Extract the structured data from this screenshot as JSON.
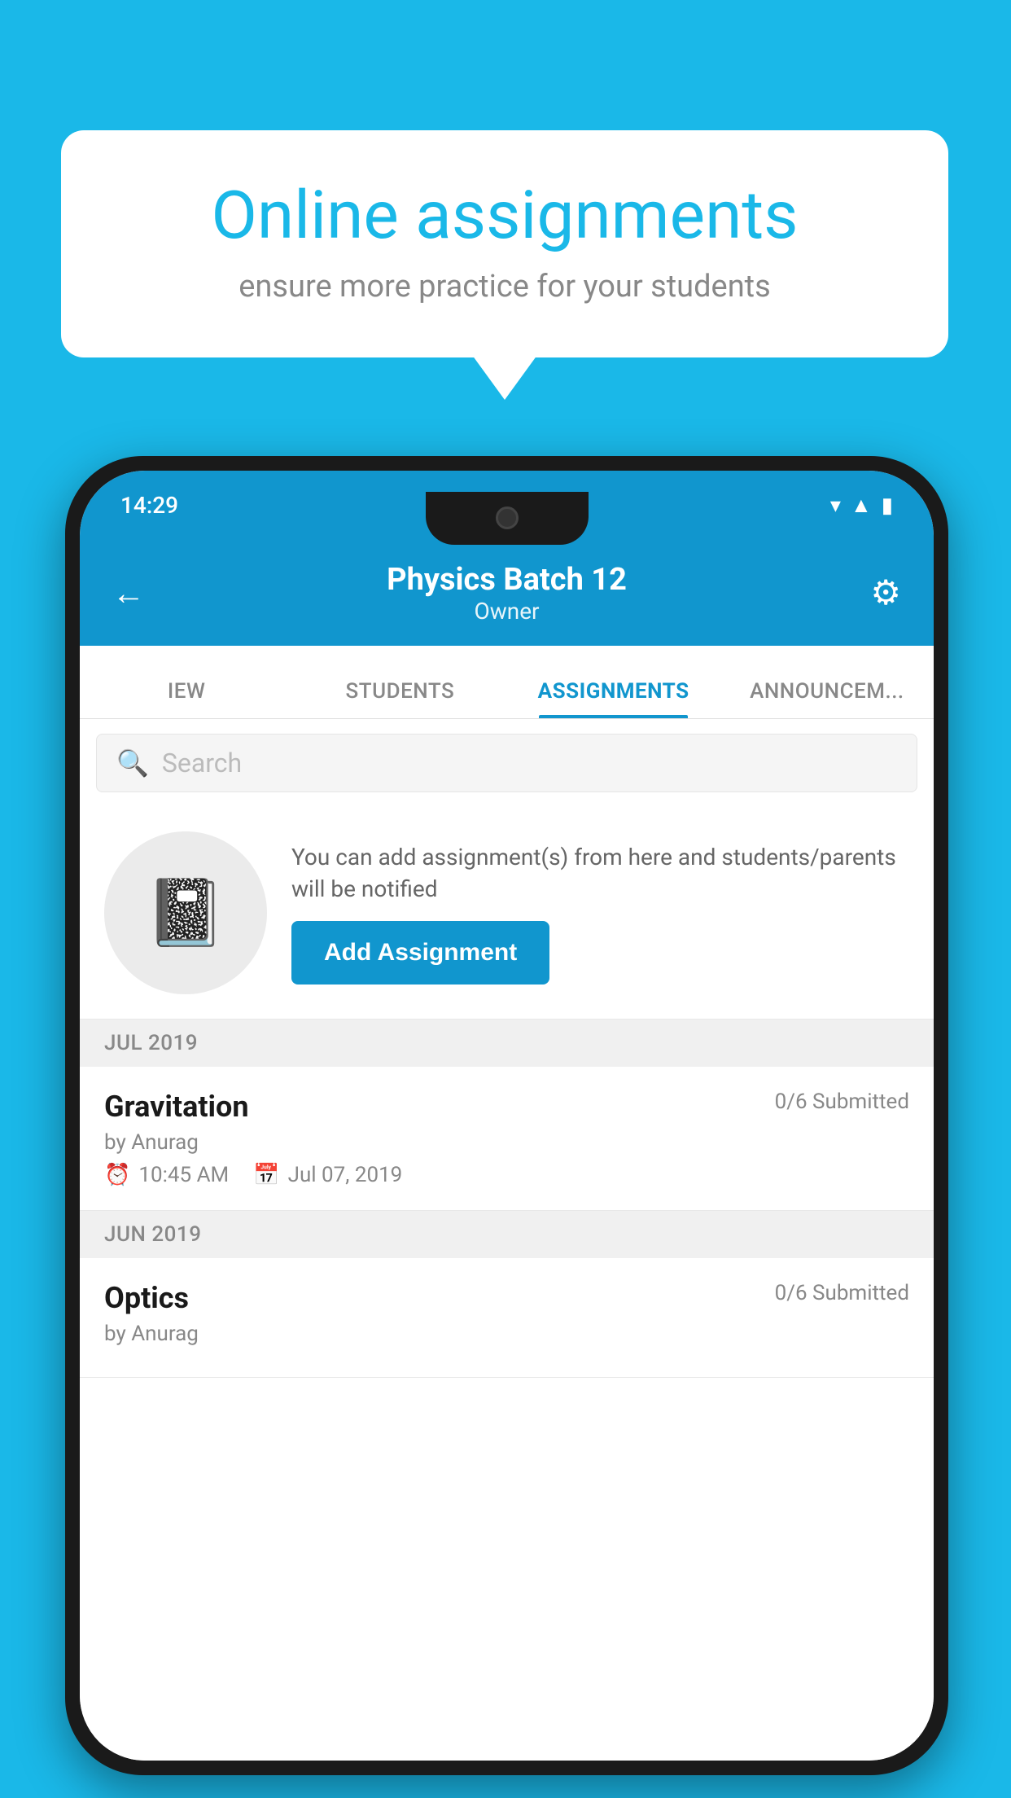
{
  "background_color": "#1ab8e8",
  "speech_bubble": {
    "title": "Online assignments",
    "subtitle": "ensure more practice for your students"
  },
  "phone": {
    "status_bar": {
      "time": "14:29",
      "icons": [
        "wifi",
        "signal",
        "battery"
      ]
    },
    "header": {
      "back_label": "←",
      "title": "Physics Batch 12",
      "subtitle": "Owner",
      "gear_label": "⚙"
    },
    "tabs": [
      {
        "label": "IEW",
        "active": false
      },
      {
        "label": "STUDENTS",
        "active": false
      },
      {
        "label": "ASSIGNMENTS",
        "active": true
      },
      {
        "label": "ANNOUNCEM...",
        "active": false
      }
    ],
    "search": {
      "placeholder": "Search"
    },
    "promo": {
      "description": "You can add assignment(s) from here and students/parents will be notified",
      "button_label": "Add Assignment"
    },
    "months": [
      {
        "label": "JUL 2019",
        "assignments": [
          {
            "name": "Gravitation",
            "submitted": "0/6 Submitted",
            "by": "by Anurag",
            "time": "10:45 AM",
            "date": "Jul 07, 2019"
          }
        ]
      },
      {
        "label": "JUN 2019",
        "assignments": [
          {
            "name": "Optics",
            "submitted": "0/6 Submitted",
            "by": "by Anurag",
            "time": "",
            "date": ""
          }
        ]
      }
    ]
  }
}
